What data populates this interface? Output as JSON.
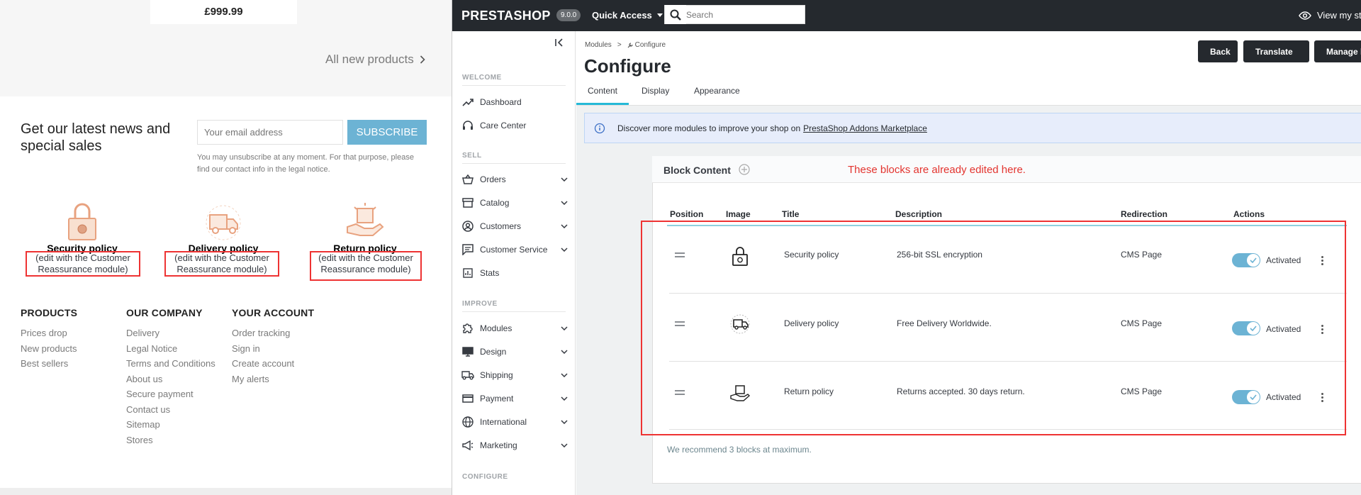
{
  "shop": {
    "price": "£999.99",
    "all_new_products": "All new products",
    "newsletter": {
      "title": "Get our latest news and special sales",
      "email_placeholder": "Your email address",
      "subscribe_label": "SUBSCRIBE",
      "note": "You may unsubscribe at any moment. For that purpose, please find our contact info in the legal notice."
    },
    "reassurance": [
      {
        "icon": "lock-icon",
        "title": "Security policy",
        "subtitle": "(edit with the Customer Reassurance module)"
      },
      {
        "icon": "truck-icon",
        "title": "Delivery policy",
        "subtitle": "(edit with the Customer Reassurance module)"
      },
      {
        "icon": "box-hand-icon",
        "title": "Return policy",
        "subtitle": "(edit with the Customer Reassurance module)"
      }
    ],
    "footer": {
      "products": {
        "title": "PRODUCTS",
        "links": [
          "Prices drop",
          "New products",
          "Best sellers"
        ]
      },
      "company": {
        "title": "OUR COMPANY",
        "links": [
          "Delivery",
          "Legal Notice",
          "Terms and Conditions",
          "About us",
          "Secure payment",
          "Contact us",
          "Sitemap",
          "Stores"
        ]
      },
      "account": {
        "title": "YOUR ACCOUNT",
        "links": [
          "Order tracking",
          "Sign in",
          "Create account",
          "My alerts"
        ]
      }
    }
  },
  "admin": {
    "logo": "PRESTASHOP",
    "version": "9.0.0",
    "quick_access": "Quick Access",
    "search_placeholder": "Search",
    "view_store": "View my store",
    "sidebar": {
      "sections": {
        "welcome": "WELCOME",
        "sell": "SELL",
        "improve": "IMPROVE",
        "configure": "CONFIGURE"
      },
      "items": [
        {
          "label": "Dashboard",
          "icon": "trending-up-icon"
        },
        {
          "label": "Care Center",
          "icon": "headset-icon"
        },
        {
          "label": "Orders",
          "icon": "basket-icon"
        },
        {
          "label": "Catalog",
          "icon": "store-icon"
        },
        {
          "label": "Customers",
          "icon": "account-icon"
        },
        {
          "label": "Customer Service",
          "icon": "chat-icon"
        },
        {
          "label": "Stats",
          "icon": "stats-icon"
        },
        {
          "label": "Modules",
          "icon": "puzzle-icon"
        },
        {
          "label": "Design",
          "icon": "monitor-icon"
        },
        {
          "label": "Shipping",
          "icon": "truck-icon"
        },
        {
          "label": "Payment",
          "icon": "credit-card-icon"
        },
        {
          "label": "International",
          "icon": "globe-icon"
        },
        {
          "label": "Marketing",
          "icon": "megaphone-icon"
        }
      ]
    },
    "breadcrumb": {
      "parent": "Modules",
      "separator": ">",
      "current": "Configure"
    },
    "page_title": "Configure",
    "header_buttons": {
      "back": "Back",
      "translate": "Translate",
      "manage_hooks": "Manage hooks"
    },
    "tabs": [
      "Content",
      "Display",
      "Appearance"
    ],
    "info_banner": {
      "text": "Discover more modules to improve your shop on",
      "link": "PrestaShop Addons Marketplace"
    },
    "block": {
      "title": "Block Content",
      "annotation": "These blocks are already edited here.",
      "columns": [
        "Position",
        "Image",
        "Title",
        "Description",
        "Redirection",
        "Actions"
      ],
      "rows": [
        {
          "title": "Security policy",
          "description": "256-bit SSL encryption",
          "redirection": "CMS Page",
          "status": "Activated",
          "icon": "lock-icon"
        },
        {
          "title": "Delivery policy",
          "description": "Free Delivery Worldwide.",
          "redirection": "CMS Page",
          "status": "Activated",
          "icon": "truck-icon"
        },
        {
          "title": "Return policy",
          "description": "Returns accepted. 30 days return.",
          "redirection": "CMS Page",
          "status": "Activated",
          "icon": "box-hand-icon"
        }
      ],
      "recommendation": "We recommend 3 blocks at maximum."
    }
  }
}
